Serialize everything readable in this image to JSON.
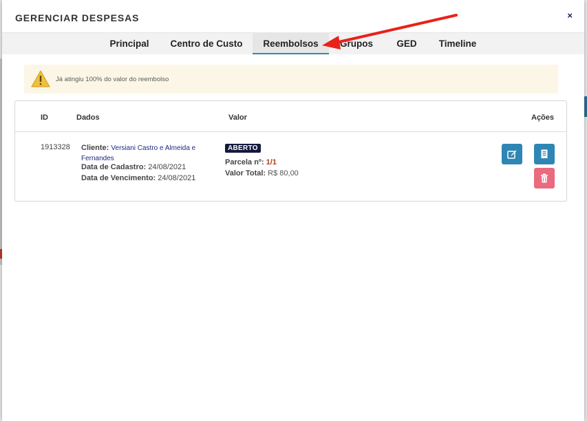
{
  "modal": {
    "title": "GERENCIAR DESPESAS",
    "close": "×"
  },
  "tabs": [
    {
      "label": "Principal",
      "active": false
    },
    {
      "label": "Centro de Custo",
      "active": false
    },
    {
      "label": "Reembolsos",
      "active": true
    },
    {
      "label": "Grupos",
      "active": false
    },
    {
      "label": "GED",
      "active": false
    },
    {
      "label": "Timeline",
      "active": false
    }
  ],
  "alert": {
    "icon": "warning-icon",
    "text": "Já atingiu 100% do valor do reembolso"
  },
  "table": {
    "headers": {
      "id": "ID",
      "dados": "Dados",
      "valor": "Valor",
      "acoes": "Ações"
    },
    "row": {
      "id": "1913328",
      "cliente_label": "Cliente:",
      "cliente": "Versiani Castro e Almeida e Fernandes",
      "cadastro_label": "Data de Cadastro:",
      "cadastro": "24/08/2021",
      "vencimento_label": "Data de Vencimento:",
      "vencimento": "24/08/2021",
      "status": "ABERTO",
      "parcela_label": "Parcela nº:",
      "parcela": "1/1",
      "valor_label": "Valor Total:",
      "valor": "R$ 80,00"
    },
    "actions": {
      "edit_icon": "edit-icon",
      "receipt_icon": "receipt-icon",
      "delete_icon": "trash-icon"
    }
  },
  "colors": {
    "accent": "#2f86b4",
    "danger": "#ea6a7e",
    "badge": "#141a3c",
    "alert_bg": "#fcf6e6",
    "annotation_arrow": "#e8221b"
  }
}
